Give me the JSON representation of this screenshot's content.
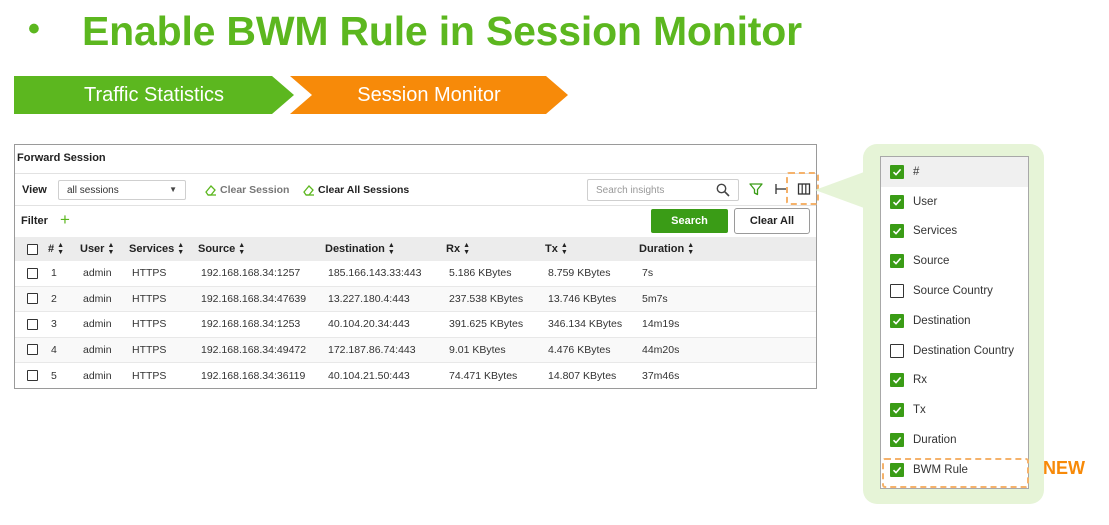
{
  "slide": {
    "bullet": "•",
    "title": "Enable BWM Rule in Session Monitor",
    "steps": [
      "Traffic Statistics",
      "Session Monitor"
    ]
  },
  "panel": {
    "title": "Forward Session",
    "view_label": "View",
    "view_value": "all sessions",
    "clear_session": "Clear Session",
    "clear_all_sessions": "Clear All Sessions",
    "search_placeholder": "Search insights",
    "filter_label": "Filter",
    "search_button": "Search",
    "clear_all_button": "Clear All"
  },
  "table": {
    "columns": [
      "#",
      "User",
      "Services",
      "Source",
      "Destination",
      "Rx",
      "Tx",
      "Duration"
    ],
    "rows": [
      {
        "n": "1",
        "user": "admin",
        "service": "HTTPS",
        "source": "192.168.168.34:1257",
        "destination": "185.166.143.33:443",
        "rx": "5.186 KBytes",
        "tx": "8.759 KBytes",
        "duration": "7s"
      },
      {
        "n": "2",
        "user": "admin",
        "service": "HTTPS",
        "source": "192.168.168.34:47639",
        "destination": "13.227.180.4:443",
        "rx": "237.538 KBytes",
        "tx": "13.746 KBytes",
        "duration": "5m7s"
      },
      {
        "n": "3",
        "user": "admin",
        "service": "HTTPS",
        "source": "192.168.168.34:1253",
        "destination": "40.104.20.34:443",
        "rx": "391.625 KBytes",
        "tx": "346.134 KBytes",
        "duration": "14m19s"
      },
      {
        "n": "4",
        "user": "admin",
        "service": "HTTPS",
        "source": "192.168.168.34:49472",
        "destination": "172.187.86.74:443",
        "rx": "9.01 KBytes",
        "tx": "4.476 KBytes",
        "duration": "44m20s"
      },
      {
        "n": "5",
        "user": "admin",
        "service": "HTTPS",
        "source": "192.168.168.34:36119",
        "destination": "40.104.21.50:443",
        "rx": "74.471 KBytes",
        "tx": "14.807 KBytes",
        "duration": "37m46s"
      }
    ]
  },
  "column_picker": {
    "items": [
      {
        "label": "#",
        "checked": true
      },
      {
        "label": "User",
        "checked": true
      },
      {
        "label": "Services",
        "checked": true
      },
      {
        "label": "Source",
        "checked": true
      },
      {
        "label": "Source Country",
        "checked": false
      },
      {
        "label": "Destination",
        "checked": true
      },
      {
        "label": "Destination Country",
        "checked": false
      },
      {
        "label": "Rx",
        "checked": true
      },
      {
        "label": "Tx",
        "checked": true
      },
      {
        "label": "Duration",
        "checked": true
      },
      {
        "label": "BWM Rule",
        "checked": true
      }
    ],
    "new_badge": "NEW"
  },
  "colors": {
    "green": "#5cb71f",
    "orange": "#f78a09",
    "button_green": "#3a9c16",
    "highlight_dash": "#f5b26b",
    "panel_bg": "#e6f4d7"
  },
  "icons": [
    "eraser-icon",
    "search-icon",
    "filter-icon",
    "pin-column-icon",
    "columns-icon",
    "plus-icon",
    "checkbox-icon",
    "sort-icon"
  ]
}
